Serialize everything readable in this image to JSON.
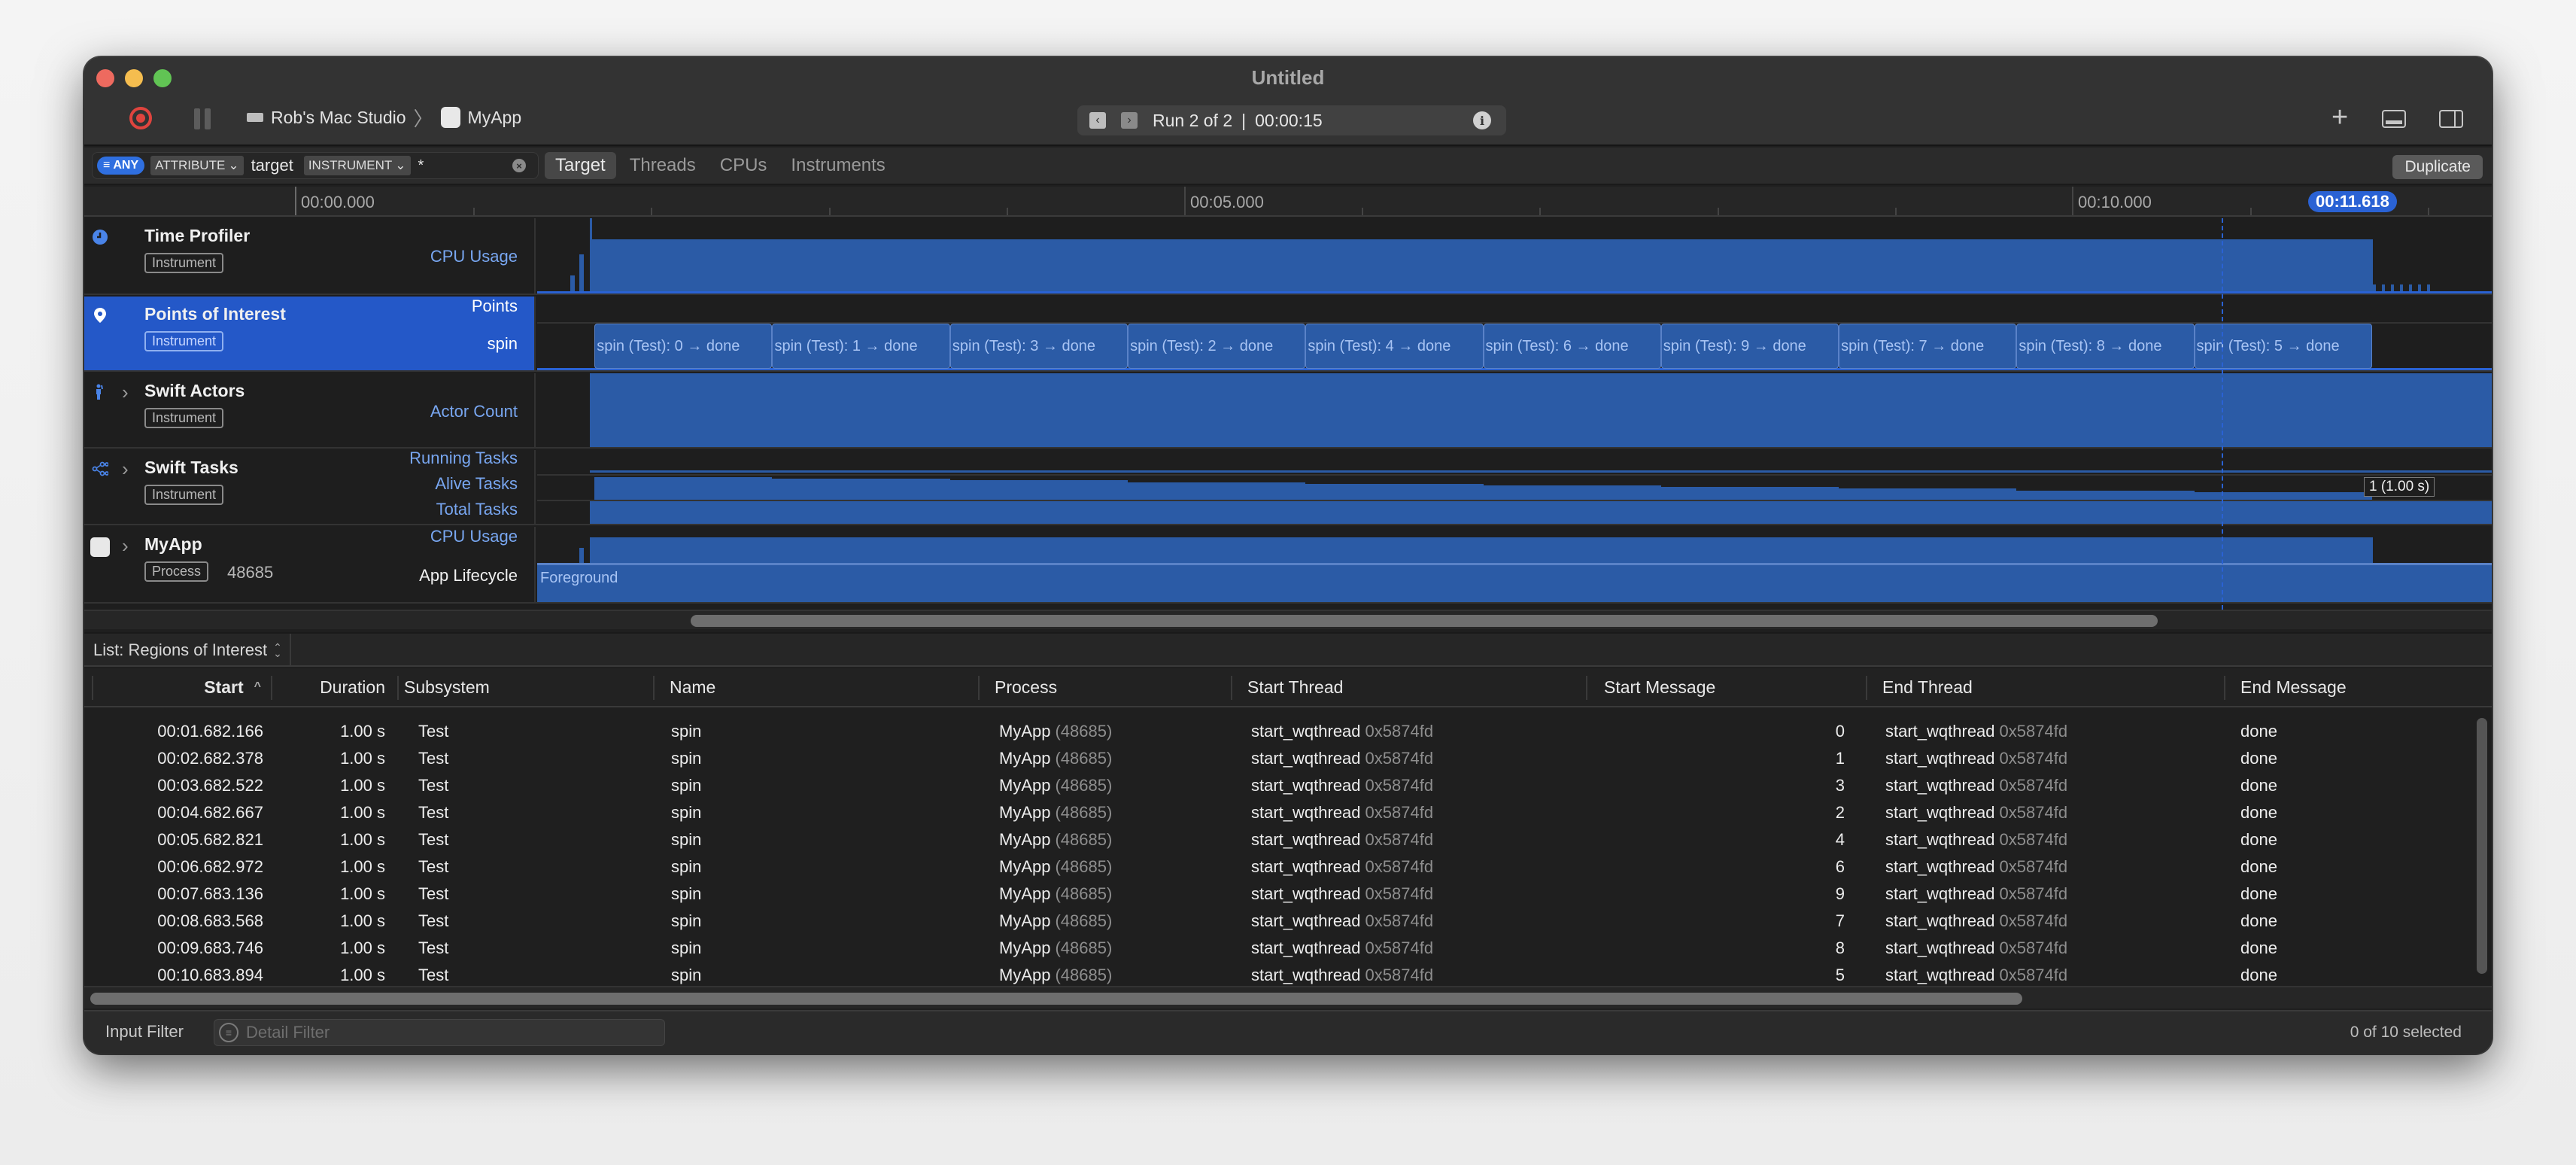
{
  "window": {
    "title": "Untitled"
  },
  "toolbar": {
    "device_name": "Rob's Mac Studio",
    "target_name": "MyApp",
    "run_label": "Run 2 of 2",
    "run_separator": "|",
    "run_duration": "00:00:15",
    "prev_glyph": "‹",
    "next_glyph": "›",
    "info_glyph": "i",
    "plus_glyph": "+",
    "crumb_separator": "〉"
  },
  "filterbar": {
    "any_label": "ANY",
    "attribute_label": "ATTRIBUTE",
    "attribute_value": "target",
    "instrument_label": "INSTRUMENT",
    "instrument_value": "*",
    "scope_tabs": [
      {
        "label": "Target",
        "active": true
      },
      {
        "label": "Threads",
        "active": false
      },
      {
        "label": "CPUs",
        "active": false
      },
      {
        "label": "Instruments",
        "active": false
      }
    ],
    "duplicate_label": "Duplicate"
  },
  "ruler": {
    "labels": [
      "00:00.000",
      "00:05.000",
      "00:10.000"
    ],
    "playhead": "00:11.618",
    "playhead_seconds": 11.618
  },
  "tracks": [
    {
      "name": "Time Profiler",
      "badge": "Instrument",
      "lanes": [
        "CPU Usage"
      ],
      "icon": "clock-icon",
      "selected": false
    },
    {
      "name": "Points of Interest",
      "badge": "Instrument",
      "lanes": [
        "Points",
        "spin"
      ],
      "icon": "location-pin-icon",
      "selected": true
    },
    {
      "name": "Swift Actors",
      "badge": "Instrument",
      "lanes": [
        "Actor Count"
      ],
      "icon": "person-icon",
      "selected": false
    },
    {
      "name": "Swift Tasks",
      "badge": "Instrument",
      "lanes": [
        "Running Tasks",
        "Alive Tasks",
        "Total Tasks"
      ],
      "icon": "task-tree-icon",
      "selected": false
    },
    {
      "name": "MyApp",
      "badge": "Process",
      "pid": "48685",
      "lanes": [
        "CPU Usage",
        "App Lifecycle"
      ],
      "icon": "app-icon",
      "selected": false
    }
  ],
  "timeline": {
    "poi_intervals": [
      {
        "label": "spin (Test): 0 → done",
        "start": 1.682
      },
      {
        "label": "spin (Test): 1 → done",
        "start": 2.682
      },
      {
        "label": "spin (Test): 3 → done",
        "start": 3.683
      },
      {
        "label": "spin (Test): 2 → done",
        "start": 4.683
      },
      {
        "label": "spin (Test): 4 → done",
        "start": 5.683
      },
      {
        "label": "spin (Test): 6 → done",
        "start": 6.683
      },
      {
        "label": "spin (Test): 9 → done",
        "start": 7.683
      },
      {
        "label": "spin (Test): 7 → done",
        "start": 8.684
      },
      {
        "label": "spin (Test): 8 → done",
        "start": 9.684
      },
      {
        "label": "spin (Test): 5 → done",
        "start": 10.684
      }
    ],
    "interval_duration_s": 1.0,
    "lifecycle_label": "Foreground",
    "alive_tasks_tooltip": "1 (1.00 s)"
  },
  "list": {
    "selector_label": "List: Regions of Interest",
    "columns": [
      "Start",
      "Duration",
      "Subsystem",
      "Name",
      "Process",
      "Start Thread",
      "Start Message",
      "End Thread",
      "End Message"
    ],
    "sort_glyph": "^",
    "rows": [
      {
        "start": "00:01.682.166",
        "duration": "1.00 s",
        "subsystem": "Test",
        "name": "spin",
        "process": "MyApp",
        "pid": "(48685)",
        "start_thread": "start_wqthread",
        "start_thread_id": "0x5874fd",
        "start_message": "0",
        "end_thread": "start_wqthread",
        "end_thread_id": "0x5874fd",
        "end_message": "done"
      },
      {
        "start": "00:02.682.378",
        "duration": "1.00 s",
        "subsystem": "Test",
        "name": "spin",
        "process": "MyApp",
        "pid": "(48685)",
        "start_thread": "start_wqthread",
        "start_thread_id": "0x5874fd",
        "start_message": "1",
        "end_thread": "start_wqthread",
        "end_thread_id": "0x5874fd",
        "end_message": "done"
      },
      {
        "start": "00:03.682.522",
        "duration": "1.00 s",
        "subsystem": "Test",
        "name": "spin",
        "process": "MyApp",
        "pid": "(48685)",
        "start_thread": "start_wqthread",
        "start_thread_id": "0x5874fd",
        "start_message": "3",
        "end_thread": "start_wqthread",
        "end_thread_id": "0x5874fd",
        "end_message": "done"
      },
      {
        "start": "00:04.682.667",
        "duration": "1.00 s",
        "subsystem": "Test",
        "name": "spin",
        "process": "MyApp",
        "pid": "(48685)",
        "start_thread": "start_wqthread",
        "start_thread_id": "0x5874fd",
        "start_message": "2",
        "end_thread": "start_wqthread",
        "end_thread_id": "0x5874fd",
        "end_message": "done"
      },
      {
        "start": "00:05.682.821",
        "duration": "1.00 s",
        "subsystem": "Test",
        "name": "spin",
        "process": "MyApp",
        "pid": "(48685)",
        "start_thread": "start_wqthread",
        "start_thread_id": "0x5874fd",
        "start_message": "4",
        "end_thread": "start_wqthread",
        "end_thread_id": "0x5874fd",
        "end_message": "done"
      },
      {
        "start": "00:06.682.972",
        "duration": "1.00 s",
        "subsystem": "Test",
        "name": "spin",
        "process": "MyApp",
        "pid": "(48685)",
        "start_thread": "start_wqthread",
        "start_thread_id": "0x5874fd",
        "start_message": "6",
        "end_thread": "start_wqthread",
        "end_thread_id": "0x5874fd",
        "end_message": "done"
      },
      {
        "start": "00:07.683.136",
        "duration": "1.00 s",
        "subsystem": "Test",
        "name": "spin",
        "process": "MyApp",
        "pid": "(48685)",
        "start_thread": "start_wqthread",
        "start_thread_id": "0x5874fd",
        "start_message": "9",
        "end_thread": "start_wqthread",
        "end_thread_id": "0x5874fd",
        "end_message": "done"
      },
      {
        "start": "00:08.683.568",
        "duration": "1.00 s",
        "subsystem": "Test",
        "name": "spin",
        "process": "MyApp",
        "pid": "(48685)",
        "start_thread": "start_wqthread",
        "start_thread_id": "0x5874fd",
        "start_message": "7",
        "end_thread": "start_wqthread",
        "end_thread_id": "0x5874fd",
        "end_message": "done"
      },
      {
        "start": "00:09.683.746",
        "duration": "1.00 s",
        "subsystem": "Test",
        "name": "spin",
        "process": "MyApp",
        "pid": "(48685)",
        "start_thread": "start_wqthread",
        "start_thread_id": "0x5874fd",
        "start_message": "8",
        "end_thread": "start_wqthread",
        "end_thread_id": "0x5874fd",
        "end_message": "done"
      },
      {
        "start": "00:10.683.894",
        "duration": "1.00 s",
        "subsystem": "Test",
        "name": "spin",
        "process": "MyApp",
        "pid": "(48685)",
        "start_thread": "start_wqthread",
        "start_thread_id": "0x5874fd",
        "start_message": "5",
        "end_thread": "start_wqthread",
        "end_thread_id": "0x5874fd",
        "end_message": "done"
      }
    ]
  },
  "footer": {
    "input_filter_label": "Input Filter",
    "detail_filter_placeholder": "Detail Filter",
    "selection_status": "0 of 10 selected"
  },
  "colors": {
    "accent": "#2a62d4",
    "graph_fill": "#2b5ba6",
    "lane_label": "#78a6f0",
    "record": "#e0443e"
  }
}
